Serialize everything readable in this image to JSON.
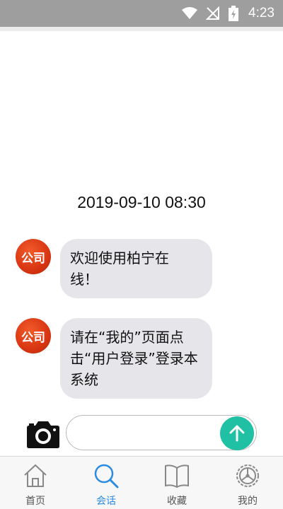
{
  "status_bar": {
    "time": "4:23"
  },
  "chat": {
    "timestamp": "2019-09-10 08:30",
    "messages": [
      {
        "sender": "公司",
        "line1": "欢迎使用柏宁在",
        "line2": "线！",
        "line3": ""
      },
      {
        "sender": "公司",
        "line1": "请在“我的”页面点",
        "line2": "击“用户登录”登录本",
        "line3": "系统"
      }
    ]
  },
  "input": {
    "value": "",
    "placeholder": ""
  },
  "nav": {
    "items": [
      {
        "label": "首页",
        "icon": "home-icon",
        "active": false
      },
      {
        "label": "会话",
        "icon": "search-icon",
        "active": true
      },
      {
        "label": "收藏",
        "icon": "book-icon",
        "active": false
      },
      {
        "label": "我的",
        "icon": "settings-icon",
        "active": false
      }
    ]
  },
  "colors": {
    "accent": "#2a8be0",
    "send": "#1fc0a4",
    "avatar": "#d83512",
    "bubble": "#e6e6ea",
    "status_bar": "#9e9e9e"
  }
}
